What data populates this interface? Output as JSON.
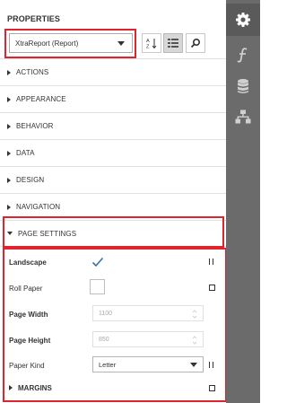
{
  "panel": {
    "title": "PROPERTIES"
  },
  "combo": {
    "value": "XtraReport (Report)"
  },
  "toolbar": {
    "sort_icon": "sort-az-icon",
    "categorize_icon": "categorize-icon",
    "search_icon": "search-icon"
  },
  "sections": [
    {
      "label": "ACTIONS",
      "expanded": false
    },
    {
      "label": "APPEARANCE",
      "expanded": false
    },
    {
      "label": "BEHAVIOR",
      "expanded": false
    },
    {
      "label": "DATA",
      "expanded": false
    },
    {
      "label": "DESIGN",
      "expanded": false
    },
    {
      "label": "NAVIGATION",
      "expanded": false
    },
    {
      "label": "PAGE SETTINGS",
      "expanded": true
    }
  ],
  "page_settings": {
    "landscape": {
      "label": "Landscape",
      "checked": true
    },
    "roll_paper": {
      "label": "Roll Paper",
      "checked": false
    },
    "page_width": {
      "label": "Page Width",
      "value": "1100"
    },
    "page_height": {
      "label": "Page Height",
      "value": "850"
    },
    "paper_kind": {
      "label": "Paper Kind",
      "value": "Letter"
    },
    "margins": {
      "label": "MARGINS"
    }
  },
  "right_toolbar": [
    {
      "icon": "gear-icon",
      "active": true
    },
    {
      "icon": "function-icon",
      "active": false
    },
    {
      "icon": "database-icon",
      "active": false
    },
    {
      "icon": "hierarchy-icon",
      "active": false
    }
  ],
  "colors": {
    "highlight": "#e0242d",
    "sidebar": "#6b6b6b",
    "text": "#333333"
  }
}
